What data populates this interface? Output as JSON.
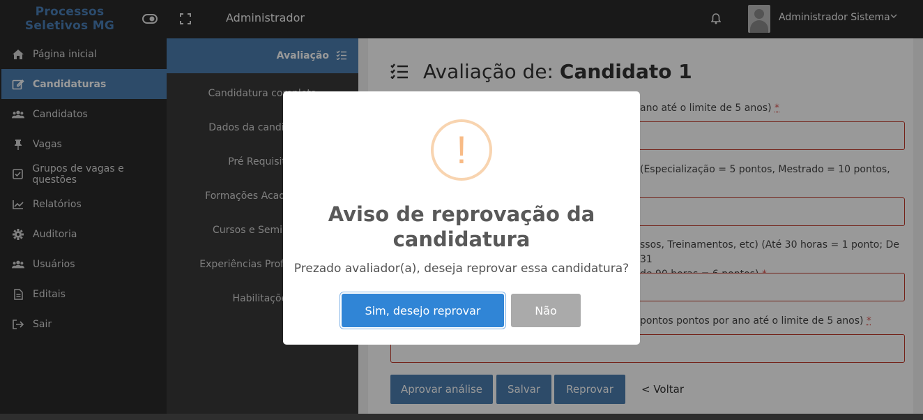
{
  "topbar": {
    "logo_line1": "Processos",
    "logo_line2": "Seletivos MG",
    "title": "Administrador",
    "user_name": "Administrador Sistema",
    "icons": [
      "toggle-icon",
      "fullscreen-icon",
      "bell-icon",
      "chevron-down-icon"
    ]
  },
  "sidebar": {
    "items": [
      {
        "label": "Página inicial",
        "icon": "home-icon"
      },
      {
        "label": "Candidaturas",
        "icon": "edit-icon",
        "active": true
      },
      {
        "label": "Candidatos",
        "icon": "users-icon"
      },
      {
        "label": "Vagas",
        "icon": "pin-icon"
      },
      {
        "label": "Grupos de vagas e questões",
        "icon": "checkbox-icon"
      },
      {
        "label": "Relatórios",
        "icon": "chart-icon"
      },
      {
        "label": "Auditoria",
        "icon": "gear-icon"
      },
      {
        "label": "Usuários",
        "icon": "users-icon"
      },
      {
        "label": "Editais",
        "icon": "file-icon"
      },
      {
        "label": "Sair",
        "icon": "sign-out-icon"
      }
    ]
  },
  "subnav": {
    "header": "Avaliação",
    "items": [
      "Candidatura completa",
      "Dados da candidatura",
      "Pré Requisitos",
      "Formações Acadêmicas",
      "Cursos e Seminários",
      "Experiências Profissionais",
      "Habilitações"
    ]
  },
  "main": {
    "title_prefix": "Avaliação de: ",
    "title_name": "Candidato 1",
    "fields": [
      {
        "label_visible": "ano até o limite de 5 anos)",
        "required": "*"
      },
      {
        "label_visible": "(Especialização = 5 pontos, Mestrado = 10 pontos,",
        "required": ""
      },
      {
        "label_line1": "ssos, Treinamentos, etc) (Até 30 horas = 1 ponto; De 31",
        "label_line2": "de 90 horas = 6 pontos)",
        "required": "*"
      },
      {
        "label_visible": "pontos pontos por ano até o limite de 5 anos)",
        "required": "*"
      }
    ],
    "buttons": {
      "approve": "Aprovar análise",
      "save": "Salvar",
      "reject": "Reprovar",
      "back": "< Voltar"
    }
  },
  "modal": {
    "icon": "warning-icon",
    "icon_glyph": "!",
    "title": "Aviso de reprovação da candidatura",
    "text": "Prezado avaliador(a), deseja reprovar essa candidatura?",
    "confirm": "Sim, desejo reprovar",
    "cancel": "Não"
  },
  "colors": {
    "accent": "#4b7eb0",
    "confirm": "#3085d6",
    "cancel": "#aaaaaa",
    "warning": "#f8bb86",
    "error_border": "#c0392b"
  }
}
